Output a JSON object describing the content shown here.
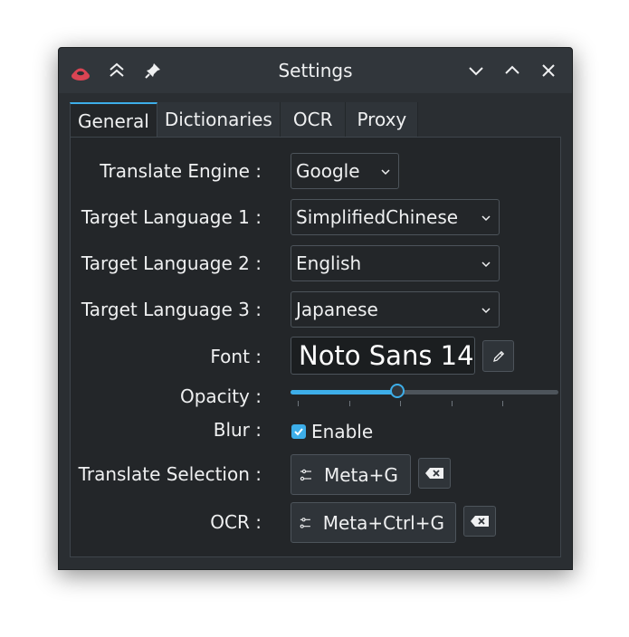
{
  "window": {
    "title": "Settings"
  },
  "titlebar": {
    "app_icon": "app-logo-icon",
    "left_buttons": [
      "keep-above-icon",
      "pin-icon"
    ],
    "right_buttons": [
      "minimize-icon",
      "maximize-icon",
      "close-icon"
    ]
  },
  "tabs": [
    {
      "label": "General",
      "active": true
    },
    {
      "label": "Dictionaries",
      "active": false
    },
    {
      "label": "OCR",
      "active": false
    },
    {
      "label": "Proxy",
      "active": false
    }
  ],
  "general": {
    "translate_engine": {
      "label": "Translate Engine :",
      "value": "Google"
    },
    "target_language_1": {
      "label": "Target Language 1 :",
      "value": "SimplifiedChinese"
    },
    "target_language_2": {
      "label": "Target Language 2 :",
      "value": "English"
    },
    "target_language_3": {
      "label": "Target Language 3 :",
      "value": "Japanese"
    },
    "font": {
      "label": "Font :",
      "value": "Noto Sans 14",
      "edit_icon": "pencil-icon"
    },
    "opacity": {
      "label": "Opacity :",
      "value_fraction": 0.4
    },
    "blur": {
      "label": "Blur :",
      "checkbox_label": "Enable",
      "checked": true
    },
    "translate_selection": {
      "label": "Translate Selection :",
      "shortcut": "Meta+G",
      "clear_icon": "clear-shortcut-icon"
    },
    "ocr": {
      "label": "OCR :",
      "shortcut": "Meta+Ctrl+G",
      "clear_icon": "clear-shortcut-icon"
    }
  },
  "colors": {
    "accent": "#3daee9",
    "window_bg": "#2a2e32",
    "panel_bg": "#232629",
    "app_logo": "#da4453"
  }
}
